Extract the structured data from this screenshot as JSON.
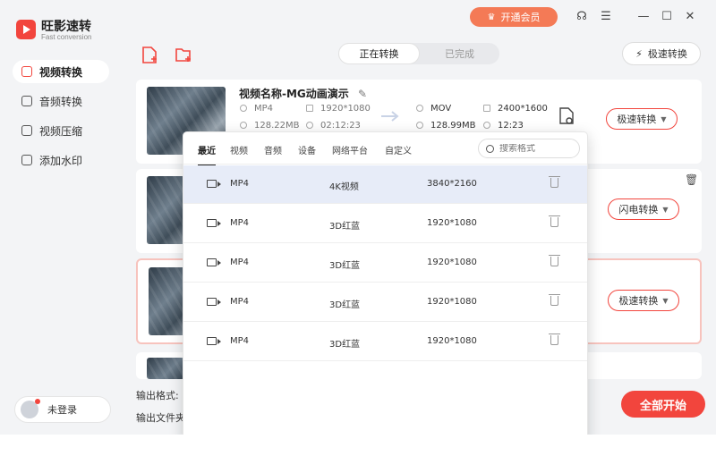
{
  "app": {
    "name": "旺影速转",
    "subtitle": "Fast conversion"
  },
  "topbar": {
    "vip_label": "开通会员",
    "icons": [
      "headset-icon",
      "menu-icon",
      "minimize-icon",
      "maximize-icon",
      "close-icon"
    ]
  },
  "sidebar": {
    "items": [
      {
        "label": "视频转换",
        "icon": "video-convert-icon",
        "active": true
      },
      {
        "label": "音频转换",
        "icon": "audio-convert-icon",
        "active": false
      },
      {
        "label": "视频压缩",
        "icon": "video-compress-icon",
        "active": false
      },
      {
        "label": "添加水印",
        "icon": "watermark-icon",
        "active": false
      }
    ],
    "login_label": "未登录"
  },
  "toolbar": {
    "tabs": [
      {
        "label": "正在转换",
        "active": true
      },
      {
        "label": "已完成",
        "active": false
      }
    ],
    "turbo_label": "极速转换"
  },
  "file": {
    "title": "视频名称-MG动画演示",
    "src_format": "MP4",
    "src_resolution": "1920*1080",
    "src_size": "128.22MB",
    "src_duration": "02:12:23",
    "dst_format": "MOV",
    "dst_resolution": "2400*1600",
    "dst_size": "128.99MB",
    "dst_duration": "12:23"
  },
  "card_buttons": [
    "极速转换",
    "闪电转换",
    "极速转换"
  ],
  "bottom": {
    "output_format_label": "输出格式:",
    "output_folder_label": "输出文件夹",
    "start_all_label": "全部开始"
  },
  "dropdown": {
    "tabs": [
      "最近",
      "视频",
      "音频",
      "设备",
      "网络平台",
      "自定义"
    ],
    "active_tab": "最近",
    "search_placeholder": "搜索格式",
    "rows": [
      {
        "format": "MP4",
        "preset": "4K视频",
        "resolution": "3840*2160"
      },
      {
        "format": "MP4",
        "preset": "3D红蓝",
        "resolution": "1920*1080"
      },
      {
        "format": "MP4",
        "preset": "3D红蓝",
        "resolution": "1920*1080"
      },
      {
        "format": "MP4",
        "preset": "3D红蓝",
        "resolution": "1920*1080"
      },
      {
        "format": "MP4",
        "preset": "3D红蓝",
        "resolution": "1920*1080"
      }
    ]
  },
  "colors": {
    "accent": "#f2453d",
    "vip": "#f47a56",
    "selected_row": "#e7ecf8"
  }
}
